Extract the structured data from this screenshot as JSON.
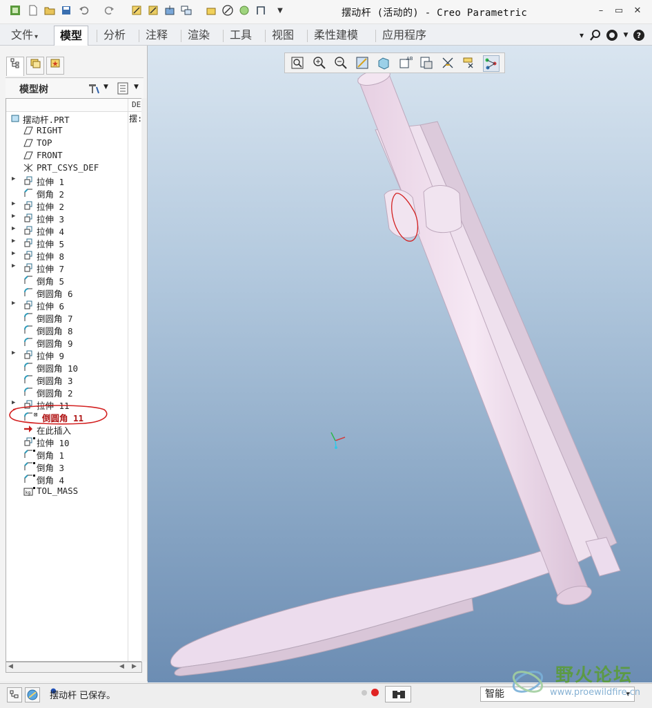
{
  "window": {
    "title": "摆动杆 (活动的) - Creo Parametric",
    "minimize": "–",
    "restore": "▭",
    "close": "✕"
  },
  "ribbon": {
    "tabs": [
      {
        "label": "文件",
        "dropdown": "▾"
      },
      {
        "label": "模型"
      },
      {
        "label": "分析"
      },
      {
        "label": "注释"
      },
      {
        "label": "渲染"
      },
      {
        "label": "工具"
      },
      {
        "label": "视图"
      },
      {
        "label": "柔性建模"
      },
      {
        "label": "应用程序"
      }
    ],
    "active_tab": "模型",
    "right_icons": [
      "chevron-down-icon",
      "search-icon",
      "community-icon",
      "help-icon"
    ]
  },
  "model_tree": {
    "title": "模型树",
    "column_header": "DE",
    "rows": [
      {
        "label": "摆动杆.PRT",
        "icon": "part-icon",
        "extra": "摆:"
      },
      {
        "label": "RIGHT",
        "icon": "datum-plane-icon"
      },
      {
        "label": "TOP",
        "icon": "datum-plane-icon"
      },
      {
        "label": "FRONT",
        "icon": "datum-plane-icon"
      },
      {
        "label": "PRT_CSYS_DEF",
        "icon": "csys-icon"
      },
      {
        "label": "拉伸 1",
        "icon": "extrude-icon",
        "expand": "▶"
      },
      {
        "label": "倒角 2",
        "icon": "chamfer-icon"
      },
      {
        "label": "拉伸 2",
        "icon": "extrude-icon",
        "expand": "▶"
      },
      {
        "label": "拉伸 3",
        "icon": "extrude-icon",
        "expand": "▶"
      },
      {
        "label": "拉伸 4",
        "icon": "extrude-icon",
        "expand": "▶"
      },
      {
        "label": "拉伸 5",
        "icon": "extrude-icon",
        "expand": "▶"
      },
      {
        "label": "拉伸 8",
        "icon": "extrude-icon",
        "expand": "▶"
      },
      {
        "label": "拉伸 7",
        "icon": "extrude-icon",
        "expand": "▶"
      },
      {
        "label": "倒角 5",
        "icon": "chamfer-icon"
      },
      {
        "label": "倒圆角 6",
        "icon": "round-icon"
      },
      {
        "label": "拉伸 6",
        "icon": "extrude-icon",
        "expand": "▶"
      },
      {
        "label": "倒圆角 7",
        "icon": "round-icon"
      },
      {
        "label": "倒圆角 8",
        "icon": "round-icon"
      },
      {
        "label": "倒圆角 9",
        "icon": "round-icon"
      },
      {
        "label": "拉伸 9",
        "icon": "extrude-icon",
        "expand": "▶"
      },
      {
        "label": "倒圆角 10",
        "icon": "round-icon"
      },
      {
        "label": "倒圆角 3",
        "icon": "round-icon"
      },
      {
        "label": "倒圆角 2",
        "icon": "round-icon"
      },
      {
        "label": "拉伸 11",
        "icon": "extrude-icon",
        "expand": "▶"
      },
      {
        "label": "倒圆角 11",
        "icon": "round-icon",
        "highlight": true
      },
      {
        "label": "在此插入",
        "icon": "insert-arrow-icon"
      },
      {
        "label": "拉伸 10",
        "icon": "extrude-icon",
        "suppressed": true
      },
      {
        "label": "倒角 1",
        "icon": "chamfer-icon",
        "suppressed": true
      },
      {
        "label": "倒角 3",
        "icon": "chamfer-icon",
        "suppressed": true
      },
      {
        "label": "倒角 4",
        "icon": "chamfer-icon",
        "suppressed": true
      },
      {
        "label": "TOL_MASS",
        "icon": "analysis-icon",
        "suppressed": true
      }
    ]
  },
  "viewport": {
    "toolbar_icons": [
      "refit-icon",
      "zoom-in-icon",
      "zoom-out-icon",
      "repaint-icon",
      "display-style-icon",
      "saved-views-icon",
      "view-manager-icon",
      "datum-display-icon",
      "annotation-display-icon",
      "spin-center-icon",
      "datum-points-icon"
    ],
    "model_color": "#efe1ee",
    "annotation_color": "#d32020"
  },
  "status": {
    "message": "摆动杆 已保存。",
    "filter": "智能",
    "filter_dropdown": "▾"
  },
  "watermark": {
    "title": "野火论坛",
    "url": "www.proewildfire.cn"
  }
}
